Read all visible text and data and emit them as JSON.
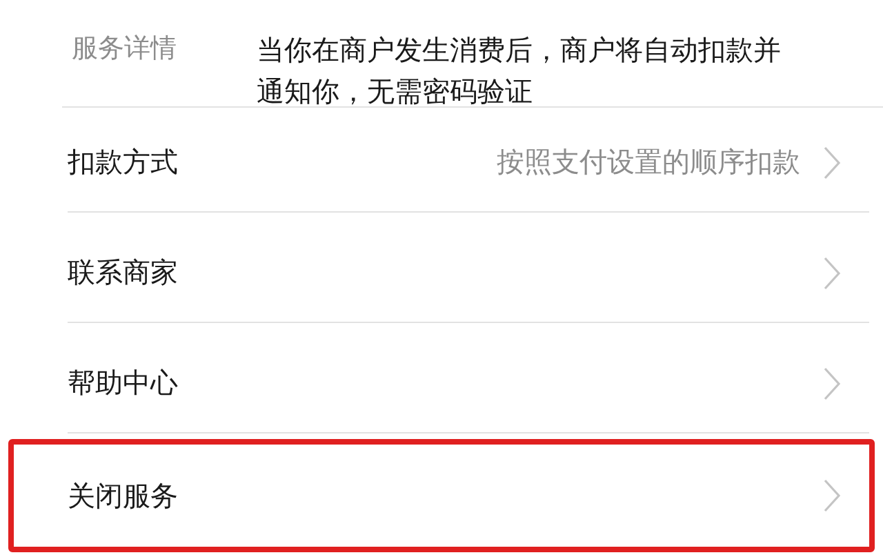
{
  "detail": {
    "label": "服务详情",
    "text": "当你在商户发生消费后，商户将自动扣款并通知你，无需密码验证"
  },
  "rows": [
    {
      "label": "扣款方式",
      "value": "按照支付设置的顺序扣款",
      "highlighted": false
    },
    {
      "label": "联系商家",
      "highlighted": false
    },
    {
      "label": "帮助中心",
      "highlighted": false
    },
    {
      "label": "关闭服务",
      "highlighted": true
    }
  ]
}
